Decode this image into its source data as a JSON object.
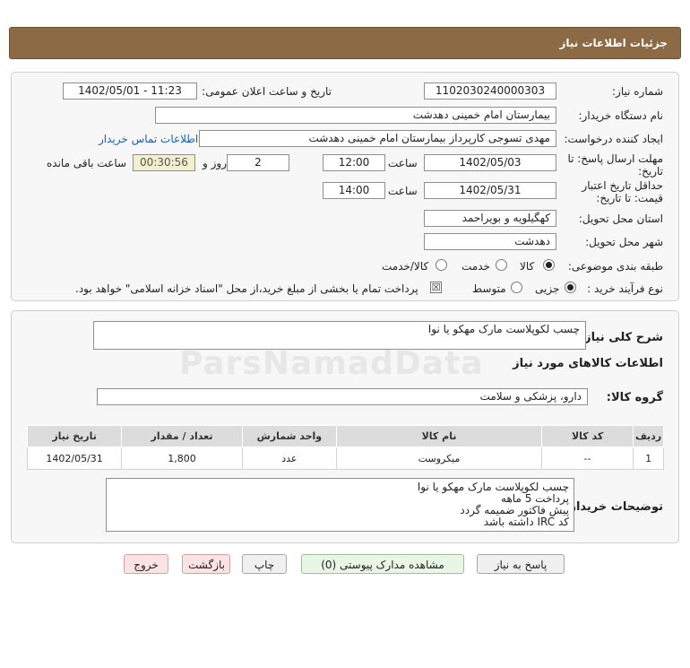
{
  "header": {
    "title": "جزئیات اطلاعات نیاز"
  },
  "form": {
    "need_number_label": "شماره نیاز:",
    "need_number": "1102030240000303",
    "announce_label": "تاریخ و ساعت اعلان عمومی:",
    "announce_value": "1402/05/01 - 11:23",
    "buyer_org_label": "نام دستگاه خریدار:",
    "buyer_org": "بیمارستان امام خمینی دهدشت",
    "requester_label": "ایجاد کننده درخواست:",
    "requester": "مهدی تسوجی کارپرداز بیمارستان امام خمینی دهدشت",
    "contact_link": "اطلاعات تماس خریدار",
    "deadline_label_1": "مهلت ارسال پاسخ: تا",
    "deadline_label_2": "تاریخ:",
    "deadline_date": "1402/05/03",
    "time_label": "ساعت",
    "deadline_time": "12:00",
    "days_value": "2",
    "days_label": "روز و",
    "remaining_time": "00:30:56",
    "remaining_label": "ساعت باقی مانده",
    "validity_label_1": "حداقل تاریخ اعتبار",
    "validity_label_2": "قیمت: تا تاریخ:",
    "validity_date": "1402/05/31",
    "validity_time_label": "ساعت",
    "validity_time": "14:00",
    "province_label": "استان محل تحویل:",
    "province": "کهگیلویه و بویراحمد",
    "city_label": "شهر محل تحویل:",
    "city": "دهدشت",
    "category_label": "طبقه بندی موضوعی:",
    "category_options": [
      "کالا",
      "خدمت",
      "کالا/خدمت"
    ],
    "purchase_type_label": "نوع فرآیند خرید :",
    "purchase_options": [
      "جزیی",
      "متوسط"
    ],
    "payment_note": "پرداخت تمام یا بخشی از مبلغ خرید،از محل \"اسناد خزانه اسلامی\" خواهد بود."
  },
  "details": {
    "summary_label": "شرح کلی نیاز:",
    "summary": "چسب لکوپلاست مارک مهکو یا نوا",
    "goods_info_title": "اطلاعات کالاهای مورد نیاز",
    "goods_group_label": "گروه کالا:",
    "goods_group": "دارو، پزشکی و سلامت",
    "table_headers": [
      "ردیف",
      "کد کالا",
      "نام کالا",
      "واحد شمارش",
      "تعداد / مقدار",
      "تاریخ نیاز"
    ],
    "table_rows": [
      [
        "1",
        "--",
        "میکروست",
        "عدد",
        "1,800",
        "1402/05/31"
      ]
    ],
    "buyer_notes_label": "توضیحات خریدار:",
    "buyer_notes": [
      "چسب لکوپلاست مارک مهکو یا نوا",
      "پرداخت 5 ماهه",
      "پیش فاکتور ضمیمه گردد",
      "کد IRC داشته باشد"
    ]
  },
  "buttons": {
    "reply": "پاسخ به نیاز",
    "attachments": "مشاهده مدارک پیوستی (0)",
    "print": "چاپ",
    "back": "بازگشت",
    "exit": "خروج"
  },
  "watermark": {
    "text": "ParsNamadData"
  },
  "colors": {
    "header_bg": "#8b6a45",
    "link": "#1a5fb4",
    "remaining_bg": "#f3f0cc"
  }
}
